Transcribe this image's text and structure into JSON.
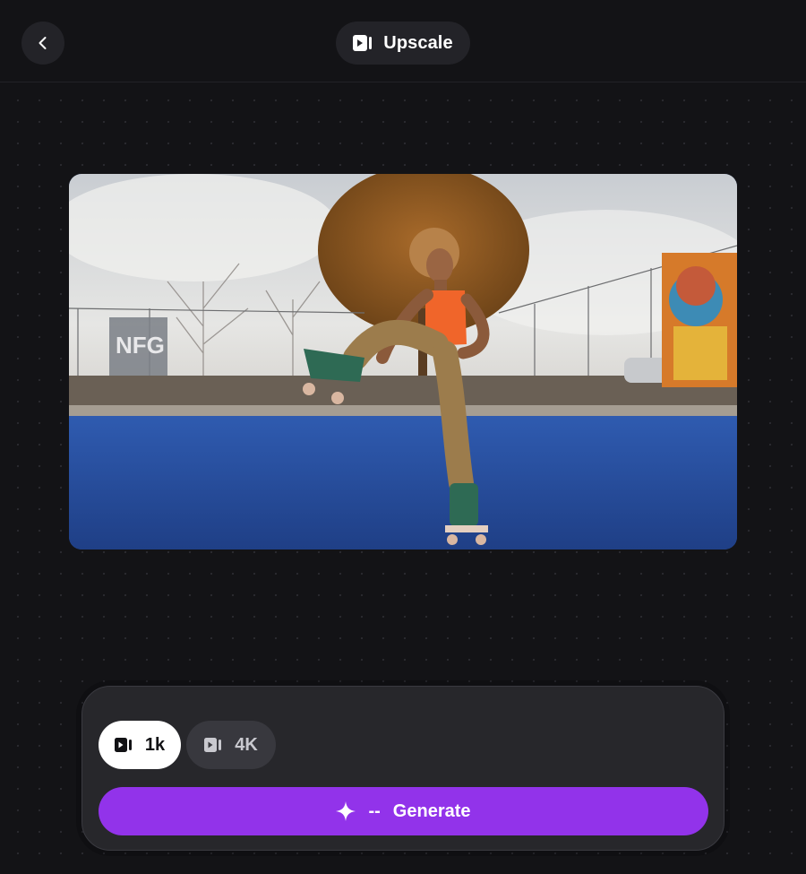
{
  "header": {
    "title": "Upscale",
    "back_icon": "chevron-left-icon",
    "title_icon": "video-play-icon"
  },
  "preview": {
    "image_icon": "video-thumbnail"
  },
  "panel": {
    "resolutions": [
      {
        "label": "1k",
        "icon": "video-play-icon",
        "selected": true
      },
      {
        "label": "4K",
        "icon": "video-play-icon",
        "selected": false
      }
    ],
    "generate": {
      "cost": "--",
      "label": "Generate",
      "icon": "sparkle-icon"
    }
  },
  "colors": {
    "background": "#131316",
    "pill": "#232328",
    "panel": "#27272b",
    "accent": "#9233ea",
    "selected": "#ffffff",
    "unselected": "#38383e"
  }
}
